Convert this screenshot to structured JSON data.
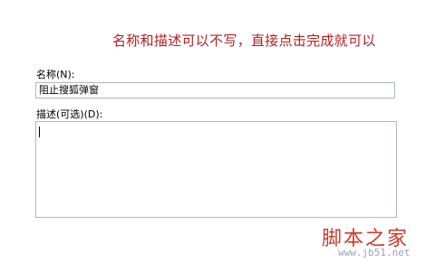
{
  "annotation": {
    "text": "名称和描述可以不写，直接点击完成就可以"
  },
  "form": {
    "name_label": "名称(N):",
    "name_value": "阻止搜狐弹窗",
    "description_label": "描述(可选)(D):",
    "description_value": ""
  },
  "watermark": {
    "brand": "脚本之家",
    "url": "www.jb51.net"
  },
  "colors": {
    "annotation": "#b11f1f",
    "field_border": "#a9b8c9",
    "watermark_brand": "#cf3a2b",
    "watermark_url": "#9aa3ad"
  }
}
